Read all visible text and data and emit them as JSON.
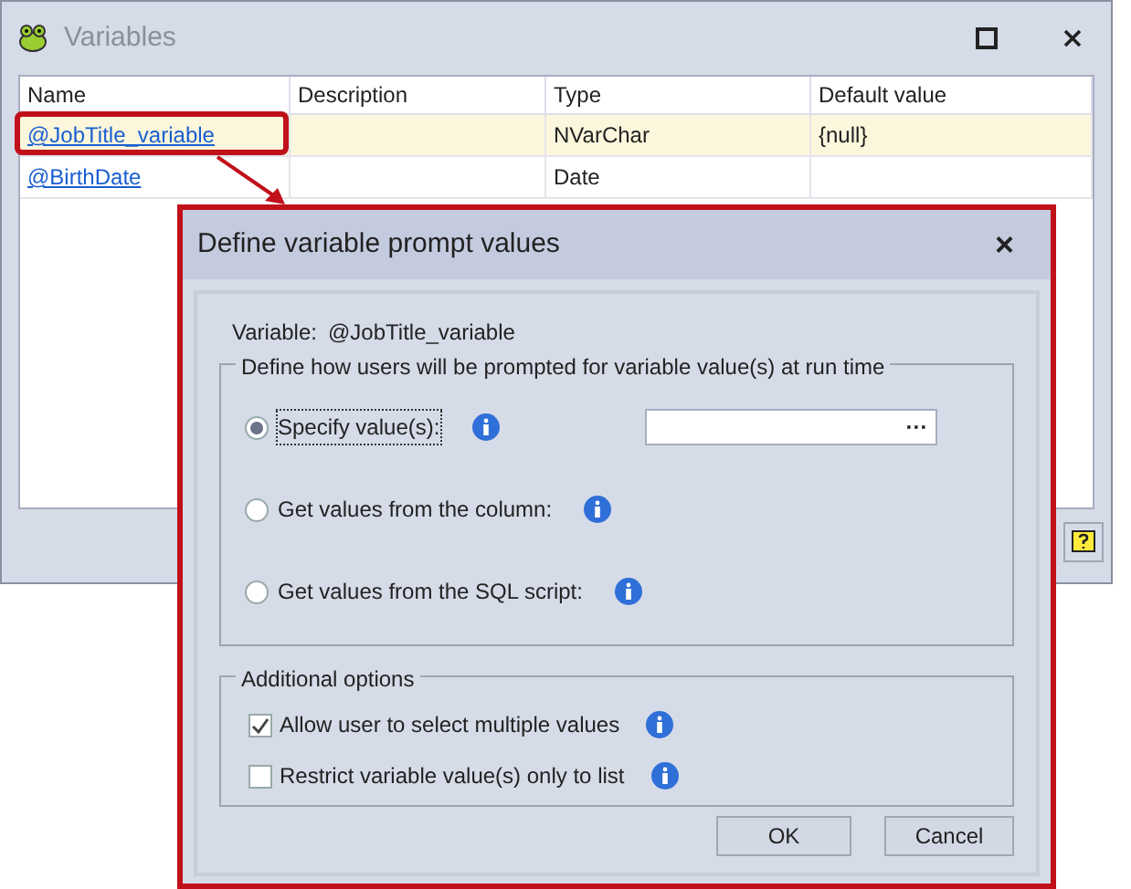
{
  "window": {
    "title": "Variables"
  },
  "table": {
    "columns": [
      "Name",
      "Description",
      "Type",
      "Default value"
    ],
    "rows": [
      {
        "selected": true,
        "cells": [
          "@JobTitle_variable",
          "",
          "NVarChar",
          "{null}"
        ]
      },
      {
        "selected": false,
        "cells": [
          "@BirthDate",
          "",
          "Date",
          ""
        ]
      }
    ]
  },
  "dialog": {
    "title": "Define variable prompt values",
    "close": "×",
    "variable_label": "Variable:",
    "variable_value": "@JobTitle_variable",
    "prompt_group": {
      "legend": "Define how users will be prompted for variable value(s) at run time",
      "options": [
        {
          "label": "Specify value(s):",
          "selected": true
        },
        {
          "label": "Get values from the column:",
          "selected": false
        },
        {
          "label": "Get values from the SQL script:",
          "selected": false
        }
      ],
      "browse": "···"
    },
    "additional_group": {
      "legend": "Additional options",
      "options": [
        {
          "label": "Allow user to select multiple values",
          "checked": true
        },
        {
          "label": "Restrict variable value(s) only to list",
          "checked": false
        }
      ]
    },
    "buttons": [
      "OK",
      "Cancel"
    ]
  }
}
